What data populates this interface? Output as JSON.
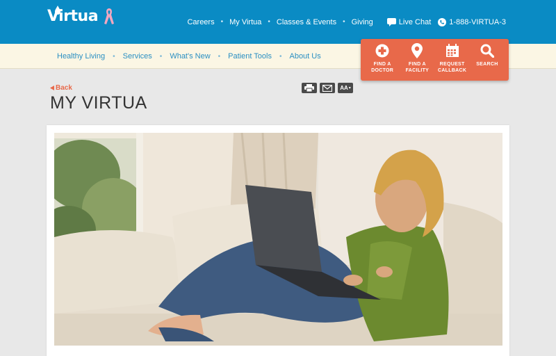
{
  "brand": {
    "name": "Virtua",
    "primary": "#0a8bc4",
    "accent": "#e8694a",
    "ribbon": "#f2a7c0"
  },
  "top_nav": {
    "items": [
      "Careers",
      "My Virtua",
      "Classes & Events",
      "Giving"
    ],
    "live_chat": "Live Chat",
    "phone": "1-888-VIRTUA-3"
  },
  "sub_nav": {
    "items": [
      "Healthy Living",
      "Services",
      "What's New",
      "Patient Tools",
      "About Us"
    ]
  },
  "quick_actions": [
    {
      "icon": "plus-circle-icon",
      "label_line1": "FIND A",
      "label_line2": "DOCTOR"
    },
    {
      "icon": "map-pin-icon",
      "label_line1": "FIND A",
      "label_line2": "FACILITY"
    },
    {
      "icon": "calendar-icon",
      "label_line1": "REQUEST",
      "label_line2": "CALLBACK"
    },
    {
      "icon": "search-icon",
      "label_line1": "SEARCH",
      "label_line2": ""
    }
  ],
  "page": {
    "back_label": "Back",
    "title": "MY VIRTUA",
    "tools": {
      "print_icon": "printer-icon",
      "email_icon": "envelope-icon",
      "text_size_label": "AA"
    }
  },
  "hero": {
    "subject": "Woman on couch using laptop"
  }
}
